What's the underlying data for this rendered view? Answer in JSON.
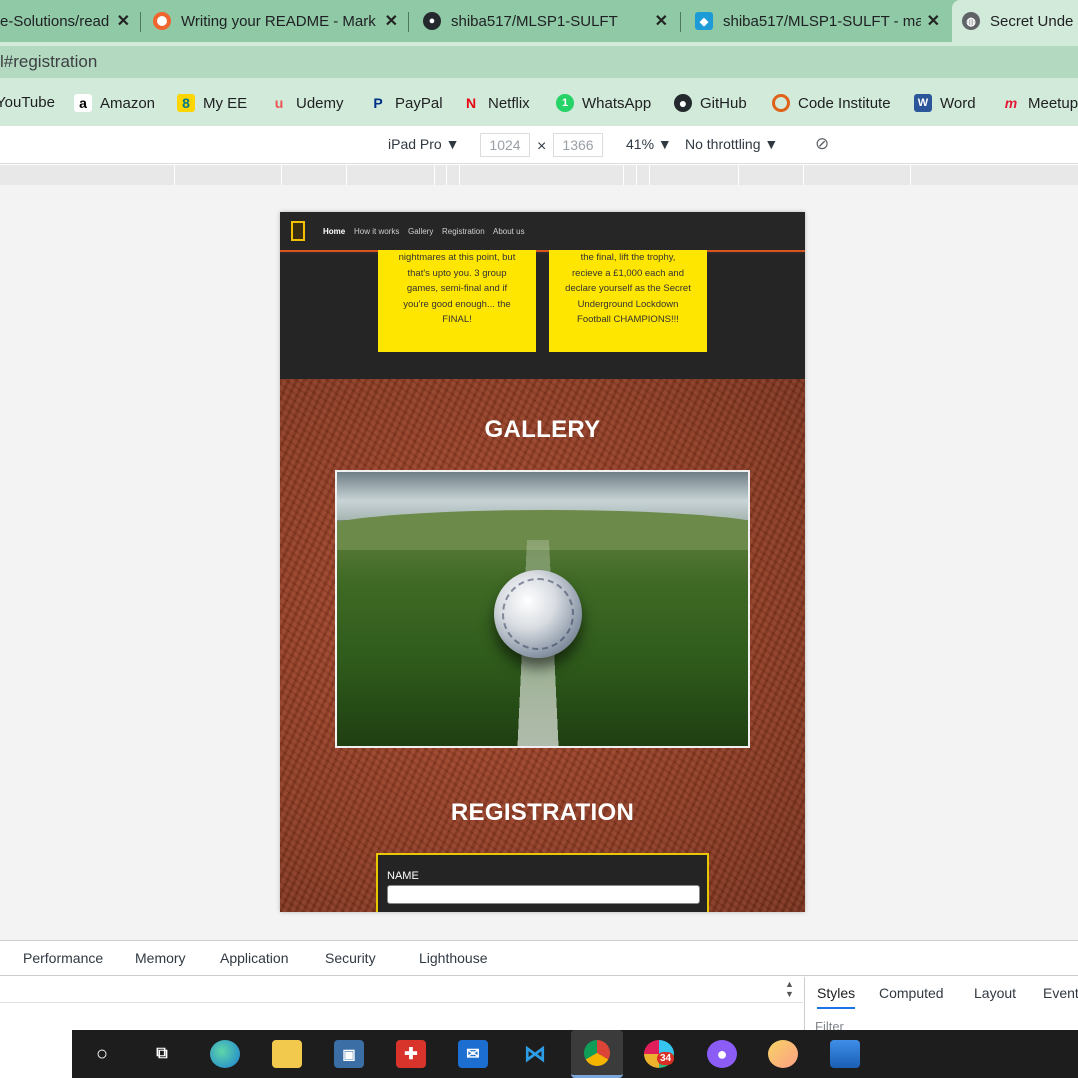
{
  "browser": {
    "tabs": [
      {
        "title": "e-Solutions/read",
        "favicon": "document-icon",
        "close": "✕"
      },
      {
        "title": "Writing your README - Mark",
        "favicon": "circle-icon",
        "close": "✕"
      },
      {
        "title": "shiba517/MLSP1-SULFT",
        "favicon": "github-icon",
        "close": "✕"
      },
      {
        "title": "shiba517/MLSP1-SULFT - ma",
        "favicon": "cube-icon",
        "close": "✕"
      },
      {
        "title": "Secret Unde",
        "favicon": "globe-icon",
        "close": ""
      }
    ],
    "address": "l#registration",
    "bookmarks": [
      {
        "label": "YouTube",
        "icon": "youtube-icon"
      },
      {
        "label": "Amazon",
        "icon": "amazon-icon"
      },
      {
        "label": "My EE",
        "icon": "ee-icon"
      },
      {
        "label": "Udemy",
        "icon": "udemy-icon"
      },
      {
        "label": "PayPal",
        "icon": "paypal-icon"
      },
      {
        "label": "Netflix",
        "icon": "netflix-icon"
      },
      {
        "label": "WhatsApp",
        "icon": "whatsapp-icon"
      },
      {
        "label": "GitHub",
        "icon": "github-icon"
      },
      {
        "label": "Code Institute",
        "icon": "code-institute-icon"
      },
      {
        "label": "Word",
        "icon": "word-icon"
      },
      {
        "label": "Meetup",
        "icon": "meetup-icon"
      }
    ]
  },
  "device_toolbar": {
    "device": "iPad Pro ▼",
    "width": "1024",
    "times": "×",
    "height": "1366",
    "zoom": "41% ▼",
    "throttling": "No throttling ▼"
  },
  "site": {
    "nav": [
      "Home",
      "How it works",
      "Gallery",
      "Registration",
      "About us"
    ],
    "cards": [
      {
        "lines": [
          "nightmares at this point, but",
          "that's upto you. 3 group",
          "games, semi-final and if",
          "you're good enough... the",
          "FINAL!"
        ]
      },
      {
        "lines": [
          "the final, lift the trophy,",
          "recieve a £1,000 each and",
          "declare yourself as the Secret",
          "Underground Lockdown",
          "Football CHAMPIONS!!!"
        ]
      }
    ],
    "gallery_title": "GALLERY",
    "registration_title": "REGISTRATION",
    "name_label": "NAME",
    "colors": {
      "accent": "#d9531e",
      "card": "#ffe600",
      "section_bg": "#8f3b22"
    }
  },
  "devtools": {
    "tabs": [
      "Performance",
      "Memory",
      "Application",
      "Security",
      "Lighthouse"
    ],
    "side_tabs": [
      "Styles",
      "Computed",
      "Layout",
      "Event"
    ],
    "filter": "Filter"
  },
  "taskbar": {
    "badge": "34",
    "apps": [
      "cortana-icon",
      "task-view-icon",
      "edge-icon",
      "file-explorer-icon",
      "store-icon",
      "gift-icon",
      "mail-icon",
      "vscode-icon",
      "chrome-icon",
      "slack-icon",
      "github-desktop-icon",
      "paint-icon",
      "photos-icon"
    ]
  }
}
